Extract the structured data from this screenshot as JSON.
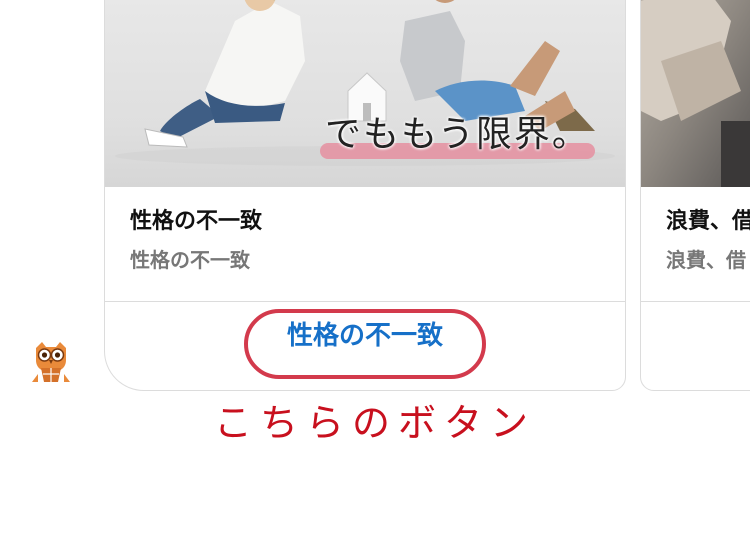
{
  "cards": [
    {
      "title": "性格の不一致",
      "subtitle": "性格の不一致",
      "image_overlay_text": "でももう限界。",
      "action_label": "性格の不一致"
    },
    {
      "title": "浪費、借",
      "subtitle": "浪費、借"
    }
  ],
  "annotation": {
    "caption": "こちらのボタン",
    "highlight_color": "#d33a4c",
    "caption_color": "#c8101e"
  },
  "colors": {
    "action_link": "#1670c8",
    "card_border": "#dcdcdc"
  },
  "icons": {
    "avatar": "owl-lawyer-icon"
  }
}
